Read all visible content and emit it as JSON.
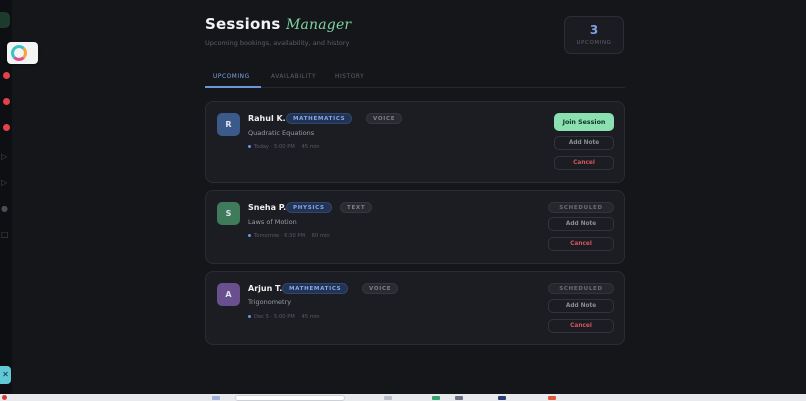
{
  "header": {
    "title": "Sessions",
    "title_accent": "Manager",
    "subtitle": "Upcoming bookings, availability, and history"
  },
  "stat": {
    "value": "3",
    "label": "UPCOMING"
  },
  "tabs": [
    {
      "label": "UPCOMING",
      "active": true
    },
    {
      "label": "AVAILABILITY",
      "active": false
    },
    {
      "label": "HISTORY",
      "active": false
    }
  ],
  "sessions": [
    {
      "initial": "R",
      "name": "Rahul K.",
      "subject": "MATHEMATICS",
      "mode": "VOICE",
      "topic": "Quadratic Equations",
      "when": "Today · 5:00 PM",
      "duration": "45 min",
      "primary_action": "Join Session",
      "status": "",
      "add_note": "Add Note",
      "cancel": "Cancel",
      "avatar_color": "#3b5a8a"
    },
    {
      "initial": "S",
      "name": "Sneha P.",
      "subject": "PHYSICS",
      "mode": "TEXT",
      "topic": "Laws of Motion",
      "when": "Tomorrow · 6:30 PM",
      "duration": "60 min",
      "primary_action": "",
      "status": "SCHEDULED",
      "add_note": "Add Note",
      "cancel": "Cancel",
      "avatar_color": "#3f7a5a"
    },
    {
      "initial": "A",
      "name": "Arjun T.",
      "subject": "MATHEMATICS",
      "mode": "VOICE",
      "topic": "Trigonometry",
      "when": "Dec 5 · 5:00 PM",
      "duration": "45 min",
      "primary_action": "",
      "status": "SCHEDULED",
      "add_note": "Add Note",
      "cancel": "Cancel",
      "avatar_color": "#6a4f8e"
    }
  ],
  "colors": {
    "background": "#15161a",
    "card": "#1c1d22",
    "accent_blue": "#7ea6ec",
    "accent_green": "#8be0b2",
    "danger": "#d4555f"
  }
}
